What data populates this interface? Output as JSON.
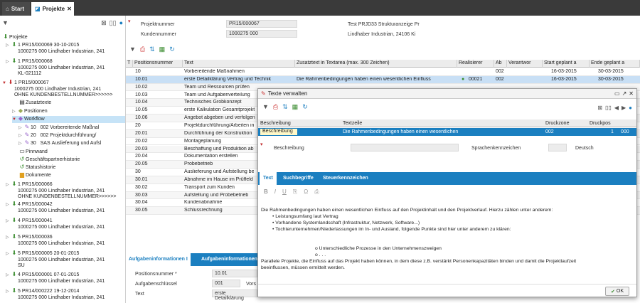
{
  "tabs": {
    "start": "Start",
    "projekte": "Projekte"
  },
  "tree": {
    "root": "Projekte",
    "items": [
      {
        "line1": "1 PR15/000069 30-10-2015",
        "line2": "1000275 000 Lindhaber Industrian, 241"
      },
      {
        "line1": "1 PR15/000068",
        "line2": "1000275 000 Lindhaber Industrian, 241",
        "line3": "KL-021112"
      },
      {
        "line1": "1 PR15/000067",
        "line2": "1000275 000 Lindhaber Industrian, 241",
        "line3": "OHNE KUNDENBESTELLNUMMER>>>>>>"
      }
    ],
    "children": [
      "Zusatztexte",
      "Positionen",
      "Workflow"
    ],
    "workflow": [
      {
        "num": "10",
        "code": "002",
        "text": "Vorbereitende Maßnal"
      },
      {
        "num": "20",
        "code": "002",
        "text": "Projektdurchführung/"
      },
      {
        "num": "30",
        "code": "SAS",
        "text": "Auslieferung und Aufsl"
      }
    ],
    "more": [
      "Pinnwand",
      "Geschäftspartnerhistorie",
      "Statushistorie",
      "Dokumente"
    ],
    "projects": [
      {
        "line1": "1 PR15/000066",
        "line2": "1000275 000 Lindhaber Industrian, 241",
        "line3": "OHNE KUNDENBESTELLNUMMER>>>>>>"
      },
      {
        "line1": "4 PR15/000042",
        "line2": "1000275 000 Lindhaber Industrian, 241"
      },
      {
        "line1": "4 PR15/000041",
        "line2": "1000275 000 Lindhaber Industrian, 241"
      },
      {
        "line1": "5 PR15/000036",
        "line2": "1000275 000 Lindhaber Industrian, 241"
      },
      {
        "line1": "5 PR15/000005 20-01-2015",
        "line2": "1000275 000 Lindhaber Industrian, 241",
        "line3": "SU"
      },
      {
        "line1": "4 PR15/000001 07-01-2015",
        "line2": "1000275 000 Lindhaber Industrian, 241"
      },
      {
        "line1": "5 PR14/000222 19-12-2014",
        "line2": "1000275 000 Lindhaber Industrian, 241"
      }
    ]
  },
  "info": {
    "projektnummer_label": "Projektnummer",
    "projektnummer": "PR15/000067",
    "kundennummer_label": "Kundennummer",
    "kundennummer": "1000275 000",
    "title": "Test PRJD33 Strukturanzeige Pr",
    "customer": "Lindhaber Industrian, 24106 Ki"
  },
  "grid": {
    "headers": [
      "T",
      "Positionsnummer",
      "Text",
      "Zusatztext in Textarea (max. 300 Zeichen)",
      "Realisierer",
      "Ab",
      "Verantwor",
      "Start geplant a",
      "Ende geplant a"
    ],
    "rows": [
      {
        "pos": "10",
        "text": "Vorbereitende Maßnahmen",
        "zusatz": "",
        "real": "",
        "ab": "002",
        "start": "16-03-2015",
        "end": "30-03-2015"
      },
      {
        "pos": "10.01",
        "text": "erste Detailklärung Vertrag und Technik",
        "zusatz": "Die Rahmenbedingungen haben einen wesentlichen Einfluss",
        "real": "00021",
        "ab": "002",
        "start": "16-03-2015",
        "end": "30-03-2015"
      },
      {
        "pos": "10.02",
        "text": "Team und Ressourcen prüfen"
      },
      {
        "pos": "10.03",
        "text": "Team und Aufgabenverteilung"
      },
      {
        "pos": "10.04",
        "text": "Technisches Grobkonzept"
      },
      {
        "pos": "10.05",
        "text": "erste Kalkulation Gesamtprojekt"
      },
      {
        "pos": "10.06",
        "text": "Angebot abgeben und verfolgen"
      },
      {
        "pos": "20",
        "text": "Projektdurchführung/Arbeiten in"
      },
      {
        "pos": "20.01",
        "text": "Durchführung der Konstruktion"
      },
      {
        "pos": "20.02",
        "text": "Montageplanung"
      },
      {
        "pos": "20.03",
        "text": "Beschaffung und Produktion ab"
      },
      {
        "pos": "20.04",
        "text": "Dokumentation erstellen"
      },
      {
        "pos": "20.05",
        "text": "Probebetrieb"
      },
      {
        "pos": "30",
        "text": "Auslieferung und Aufstellung be"
      },
      {
        "pos": "30.01",
        "text": "Abnahme im Hause im Prüffeld"
      },
      {
        "pos": "30.02",
        "text": "Transport zum Kunden"
      },
      {
        "pos": "30.03",
        "text": "Aufstellung und Probebetrieb"
      },
      {
        "pos": "30.04",
        "text": "Kundenabnahme"
      },
      {
        "pos": "30.05",
        "text": "Schlussrechnung"
      }
    ]
  },
  "bottom": {
    "tab1": "Aufgabeninformationen I",
    "tab2": "Aufgabeninformationen",
    "f1_label": "Positionsnummer *",
    "f1": "10.01",
    "f2_label": "Aufgabenschlüssel",
    "f2": "001",
    "f2_extra": "Vors",
    "f3_label": "Text",
    "f3": "erste Detailklärung"
  },
  "dialog": {
    "title": "Texte verwalten",
    "headers": [
      "Beschreibung",
      "Textzeile",
      "Druckzone",
      "Druckpos"
    ],
    "row": {
      "beschreibung": "Beschreibung",
      "textzeile": "Die Rahmenbedingungen haben einen wesentlichen",
      "druckzone": "002",
      "druckpos": "1",
      "extra": "000"
    },
    "form": {
      "beschreibung_label": "Beschreibung",
      "sprachen_label": "Sprachenkennzeichen",
      "sprache": "Deutsch"
    },
    "tabs": [
      "Text",
      "Suchbegriffe",
      "Steuerkennzeichen"
    ],
    "editor": {
      "intro": "Die Rahmenbedingungen haben einen wesentlichen Einfluss auf den Projektinhalt und den Projektverlauf. Hierzu zählen unter anderem:",
      "bullets": [
        "Leistungsumfang laut Vertrag",
        "Vorhandene Systemlandschaft (Infrastruktur, Netzwerk, Software...)",
        "Tochterunternehmen/Niederlassungen im In- und Ausland, folgende Punkte sind hier unter anderem zu klären:"
      ],
      "sub": [
        "o Unterschiedliche Prozesse in den Unternehmenszweigen",
        "o . . ."
      ],
      "outro1": "Parallele Projekte, die Einfluss auf das Projekt haben können, in dem diese z.B. verstärkt Personenkapazitäten binden und damit die Projektlaufzeit",
      "outro2": "beeinflussen, müssen ermittelt werden."
    },
    "ok": "OK"
  }
}
